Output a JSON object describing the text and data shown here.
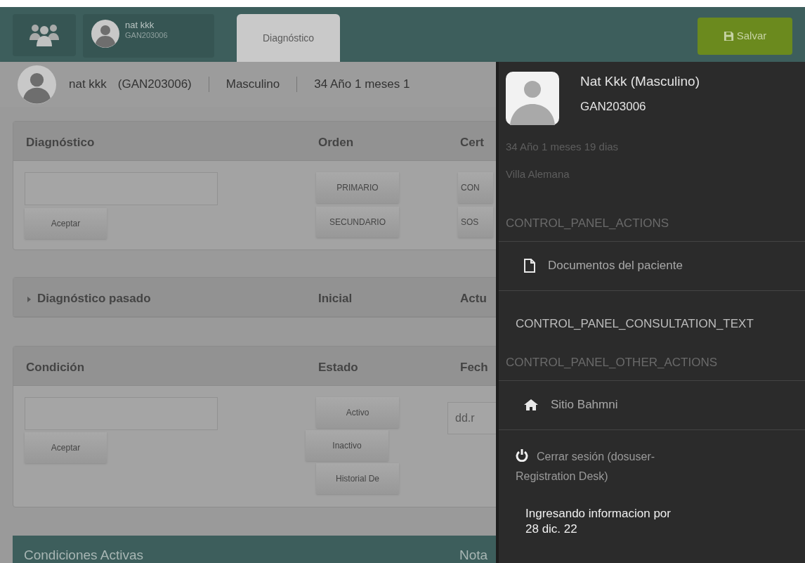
{
  "header": {
    "patient": {
      "name": "nat kkk",
      "id": "GAN203006"
    },
    "tabs": [
      {
        "label": "Diagnóstico",
        "selected": true
      }
    ],
    "save_button": "Salvar"
  },
  "patient_bar": {
    "name": "nat kkk",
    "id": "(GAN203006)",
    "gender": "Masculino",
    "age": "34 Año 1 meses 1"
  },
  "diagnosis_panel": {
    "columns": [
      "Diagnóstico",
      "Orden",
      "Cert"
    ],
    "accept_button": "Aceptar",
    "order_buttons": [
      "PRIMARIO",
      "SECUNDARIO"
    ],
    "certainty_buttons": [
      "CON",
      "SOS"
    ]
  },
  "past_diagnosis": {
    "expanded": false,
    "columns": [
      "Diagnóstico pasado",
      "Inicial",
      "Actu"
    ]
  },
  "condition_panel": {
    "columns": [
      "Condición",
      "Estado",
      "Fech"
    ],
    "accept_button": "Aceptar",
    "status_buttons": [
      "Activo",
      "Inactivo",
      "Historial De"
    ],
    "date_placeholder": "dd.r"
  },
  "active_conditions": {
    "title": "Condiciones Activas",
    "column_2": "Nota"
  },
  "drawer": {
    "name": "Nat Kkk (Masculino)",
    "id": "GAN203006",
    "age": "34 Año 1 meses 19 dias",
    "city": "Villa Alemana",
    "sections": [
      {
        "kind": "heading",
        "label": "CONTROL_PANEL_ACTIONS"
      },
      {
        "kind": "documents",
        "label": "Documentos del paciente"
      },
      {
        "kind": "text",
        "label": "CONTROL_PANEL_CONSULTATION_TEXT"
      },
      {
        "kind": "heading",
        "label": "CONTROL_PANEL_OTHER_ACTIONS"
      },
      {
        "kind": "site",
        "label": "Sitio Bahmni"
      },
      {
        "kind": "logout",
        "label": "Cerrar sesión (dosuser-Registration Desk)"
      }
    ],
    "footer": [
      "Ingresando informacion por",
      "28 dic. 22"
    ]
  }
}
